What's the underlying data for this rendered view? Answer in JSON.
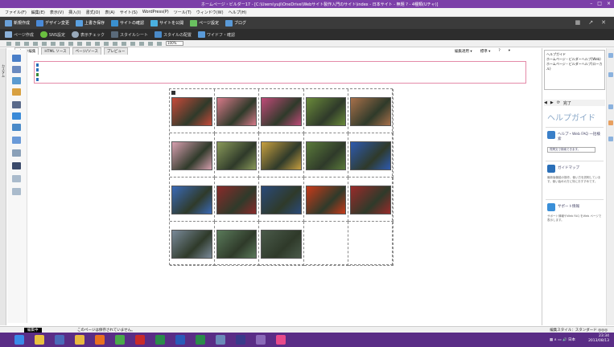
{
  "window": {
    "title": "ホームページ・ビルダー17 - [C:\\Users\\yuji\\OneDrive\\Webサイト製作入門のサイト\\index - 日本サイト - 無題 ? - 4種類(Uチャ)]",
    "buttons": [
      "–",
      "□",
      "×"
    ]
  },
  "menu": [
    "ファイル(F)",
    "編集(E)",
    "表示(V)",
    "挿入(I)",
    "書式(O)",
    "表(A)",
    "サイト(S)",
    "WordPress(P)",
    "ツール(T)",
    "ウィンドウ(W)",
    "ヘルプ(H)"
  ],
  "ribbon": {
    "row1": [
      "新規作成",
      "デザイン変更",
      "上書き保存",
      "サイトの確認",
      "サイトを公開",
      "ページ設定",
      "ブログ"
    ],
    "row1_right": [
      "▦",
      "↗",
      "✕"
    ],
    "row2": [
      "ページ作成",
      "SNS設定",
      "表示チェック",
      "スタイルシート",
      "スタイルの配置",
      "ワイドフ・確認"
    ]
  },
  "toolbar": {
    "zoom": "100%"
  },
  "tabs": [
    {
      "label": "ページ編集",
      "active": true
    },
    {
      "label": "HTML ソース",
      "active": false
    },
    {
      "label": "ページ/ソース",
      "active": false
    },
    {
      "label": "プレビュー",
      "active": false
    }
  ],
  "tabs_right": [
    "編集適用 ▾",
    "標準 ▾",
    "?",
    "▾"
  ],
  "leftbar": {
    "label": "カスタム"
  },
  "grid": {
    "columns": 5,
    "rows": 4,
    "photos": [
      {
        "name": "photo-flowers-1",
        "color": "#c84a3a"
      },
      {
        "name": "photo-flowers-2",
        "color": "#d87a8a"
      },
      {
        "name": "photo-flowers-3",
        "color": "#c04a78"
      },
      {
        "name": "photo-flowers-4",
        "color": "#6a8a3a"
      },
      {
        "name": "photo-flowers-5",
        "color": "#a8704a"
      },
      {
        "name": "photo-flowers-6",
        "color": "#d8a0b0"
      },
      {
        "name": "photo-flowers-7",
        "color": "#8a9a5a"
      },
      {
        "name": "photo-flowers-8",
        "color": "#c8a040"
      },
      {
        "name": "photo-tree-1",
        "color": "#5a7a3a"
      },
      {
        "name": "photo-sky-1",
        "color": "#2d5ab0"
      },
      {
        "name": "photo-autumn-1",
        "color": "#3a6ab8"
      },
      {
        "name": "photo-autumn-2",
        "color": "#8a2a2a"
      },
      {
        "name": "photo-autumn-3",
        "color": "#2a4a7a"
      },
      {
        "name": "photo-autumn-4",
        "color": "#c83a1a"
      },
      {
        "name": "photo-autumn-5",
        "color": "#9a2a2a"
      },
      {
        "name": "photo-garden-1",
        "color": "#7a8a9a"
      },
      {
        "name": "photo-garden-2",
        "color": "#5a7a5a"
      },
      {
        "name": "photo-pond-1",
        "color": "#4a5a4a"
      }
    ]
  },
  "sitetree": {
    "lines": [
      "ヘルプガイド",
      "ホームページ・ビルダーヘルプ(Web)",
      "ホームページ・ビルダーヘルプ(ローカル)"
    ]
  },
  "navbar": [
    "◀",
    "▶",
    "⟳",
    "完了"
  ],
  "help": {
    "title": "ヘルプガイド",
    "sections": [
      {
        "title": "ヘルプ・Web FAQ 一括検索",
        "desc": "",
        "button": "質問文で検索できます。",
        "color": "#3a7fc8"
      },
      {
        "title": "ガイドマップ",
        "desc": "最新版機能の操作、使い方を説明しています。使い始めの方に特におすすめです。",
        "button": "",
        "color": "#2a6fb8"
      },
      {
        "title": "サポート情報",
        "desc": "サポート情報やWeb FAQ をWeb ページで表示します。",
        "button": "",
        "color": "#3a8fd8"
      }
    ]
  },
  "status": {
    "mode": "編集中",
    "message": "このページは保存されていません。",
    "right": "編集スタイル：スタンダード ◎◎◎"
  },
  "taskbar": {
    "icons": [
      {
        "name": "ie-icon",
        "color": "#3a8ae8"
      },
      {
        "name": "explorer-icon",
        "color": "#e8c040"
      },
      {
        "name": "people-icon",
        "color": "#4a6ab8"
      },
      {
        "name": "folder-icon",
        "color": "#e8b840"
      },
      {
        "name": "firefox-icon",
        "color": "#e87020"
      },
      {
        "name": "chrome-icon",
        "color": "#4aa84a"
      },
      {
        "name": "opera-icon",
        "color": "#c82a2a"
      },
      {
        "name": "dw-icon",
        "color": "#2a8a4a"
      },
      {
        "name": "word-icon",
        "color": "#2a5ab8"
      },
      {
        "name": "excel-icon",
        "color": "#2a8a4a"
      },
      {
        "name": "ftp-icon",
        "color": "#6a8ab8"
      },
      {
        "name": "vs-icon",
        "color": "#3a3a8a"
      },
      {
        "name": "paint-icon",
        "color": "#8a6ab8"
      },
      {
        "name": "hpb-icon",
        "color": "#e84a8a"
      }
    ],
    "tray": "▦ ∧ ▭ 🔊 日本",
    "time": "23:34",
    "date": "2013/08/13"
  }
}
